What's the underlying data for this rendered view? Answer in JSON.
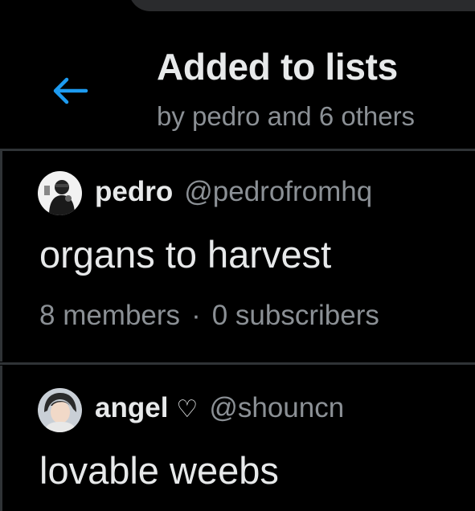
{
  "header": {
    "title": "Added to lists",
    "subtitle": "by pedro and 6 others",
    "back_icon_color": "#1d9bf0"
  },
  "lists": [
    {
      "owner_name": "pedro",
      "owner_handle": "@pedrofromhq",
      "list_name": "organs to harvest",
      "members": "8 members",
      "separator": "·",
      "subscribers": "0 subscribers"
    },
    {
      "owner_name": "angel",
      "owner_badge": "♡",
      "owner_handle": "@shouncn",
      "list_name": "lovable weebs"
    }
  ],
  "colors": {
    "background": "#000000",
    "primary_text": "#e7e9ea",
    "secondary_text": "#8b9095",
    "divider": "#2f3336",
    "accent": "#1d9bf0"
  }
}
